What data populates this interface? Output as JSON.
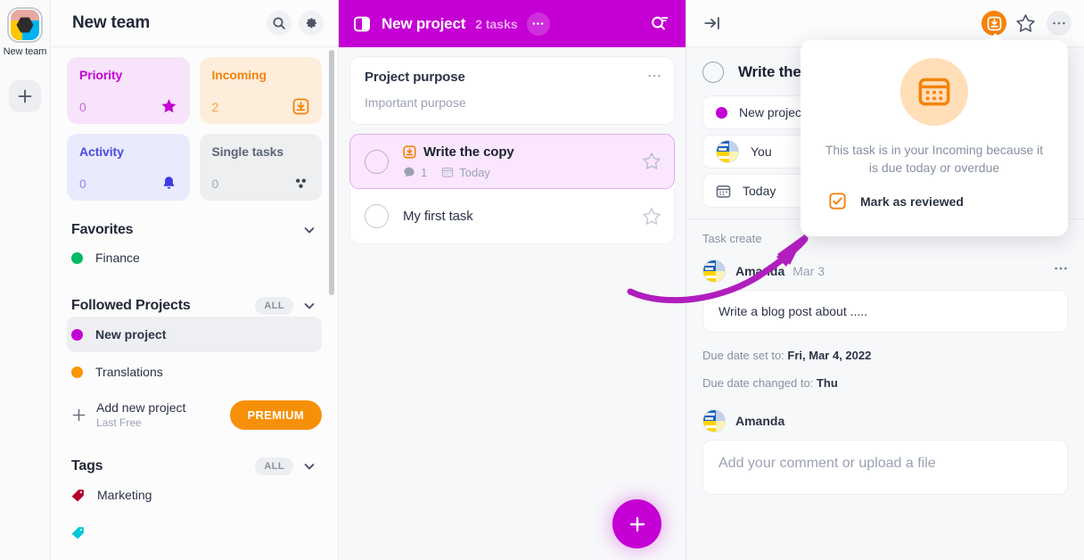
{
  "rail": {
    "team_logo_name": "team-logo",
    "team_label": "New team",
    "add_label": "+"
  },
  "sidebar": {
    "title": "New team",
    "search_icon": "search-icon",
    "settings_icon": "gear-icon",
    "stats": [
      {
        "label": "Priority",
        "count": "0",
        "icon": "star-icon",
        "bg": "#f7e3fa",
        "label_color": "#c400d4",
        "num_color": "#c76ad6",
        "icon_color": "#c400d4"
      },
      {
        "label": "Incoming",
        "count": "2",
        "icon": "inbox-down-icon",
        "bg": "#fdeedc",
        "label_color": "#f4830b",
        "num_color": "#f4a33b",
        "icon_color": "#f4830b"
      },
      {
        "label": "Activity",
        "count": "0",
        "icon": "bell-icon",
        "bg": "#e9eafc",
        "label_color": "#4a4ae0",
        "num_color": "#8b8be8",
        "icon_color": "#3c3ce6"
      },
      {
        "label": "Single tasks",
        "count": "0",
        "icon": "dots-cluster-icon",
        "bg": "#eeeff1",
        "label_color": "#5c6578",
        "num_color": "#a3aab6",
        "icon_color": "#3e4654"
      }
    ],
    "sections": [
      {
        "title": "Favorites",
        "pill": null,
        "chevron": "chevron-down-icon"
      },
      {
        "title": "Followed Projects",
        "pill": "ALL",
        "chevron": "chevron-down-icon"
      },
      {
        "title": "Tags",
        "pill": "ALL",
        "chevron": "chevron-down-icon"
      }
    ],
    "favorites": [
      {
        "label": "Finance",
        "color": "#00b964"
      }
    ],
    "projects": [
      {
        "label": "New project",
        "color": "#c400d4",
        "active": true
      },
      {
        "label": "Translations",
        "color": "#fa9600",
        "active": false
      }
    ],
    "add_project": {
      "title": "Add new project",
      "subtitle": "Last Free",
      "plus_icon": "plus-icon",
      "premium_label": "PREMIUM"
    },
    "tags": [
      {
        "label": "Marketing",
        "color": "#b5002e"
      },
      {
        "label": "",
        "color": "#00c8d7"
      }
    ]
  },
  "project": {
    "header": {
      "panel_icon": "panel-toggle-icon",
      "title": "New project",
      "task_count": "2 tasks",
      "more_icon": "ellipsis-icon",
      "search_icon": "search-filter-icon",
      "bg_color": "#c400d4"
    },
    "purpose": {
      "title": "Project purpose",
      "body": "Important purpose",
      "more_icon": "ellipsis-icon"
    },
    "tasks": [
      {
        "title": "Write the copy",
        "selected": true,
        "badge_icon": "inbox-down-icon",
        "comments": "1",
        "comments_icon": "comment-icon",
        "due_icon": "calendar-icon",
        "due": "Today",
        "star_icon": "star-outline-icon"
      },
      {
        "title": "My first task",
        "selected": false,
        "badge_icon": null,
        "comments": null,
        "due": null,
        "star_icon": "star-outline-icon"
      }
    ],
    "fab_icon": "plus-icon"
  },
  "detail": {
    "toolbar": {
      "collapse_icon": "collapse-right-icon",
      "incoming_icon": "inbox-down-icon",
      "star_icon": "star-outline-icon",
      "more_icon": "ellipsis-icon"
    },
    "task_title": "Write the c",
    "properties": [
      {
        "label": "New project",
        "icon": "project-dot-icon",
        "color": "#c400d4"
      },
      {
        "label": "You",
        "icon": "avatar-icon",
        "color": null
      },
      {
        "label": "Today",
        "icon": "calendar-icon",
        "color": null
      }
    ],
    "activity": {
      "created_text": "Task create",
      "comment": {
        "author": "Amanda",
        "date": "Mar 3",
        "text": "Write a blog post about .....",
        "more_icon": "ellipsis-icon"
      },
      "events": [
        {
          "prefix": "Due date set to: ",
          "value": "Fri, Mar 4, 2022"
        },
        {
          "prefix": "Due date changed to: ",
          "value": "Thu"
        }
      ],
      "composer": {
        "author": "Amanda",
        "placeholder": "Add your comment or upload a file"
      }
    }
  },
  "popup": {
    "icon": "calendar-icon",
    "icon_bg": "#ffdeb8",
    "icon_color": "#f4830b",
    "message": "This task is in your Incoming because it is due today or overdue",
    "checkbox_label": "Mark as reviewed",
    "checkbox_icon": "checkbox-checked-icon",
    "checkbox_color": "#f4830b"
  },
  "annotation": {
    "arrow_color": "#b01ebd",
    "arrow_name": "highlight-arrow"
  }
}
